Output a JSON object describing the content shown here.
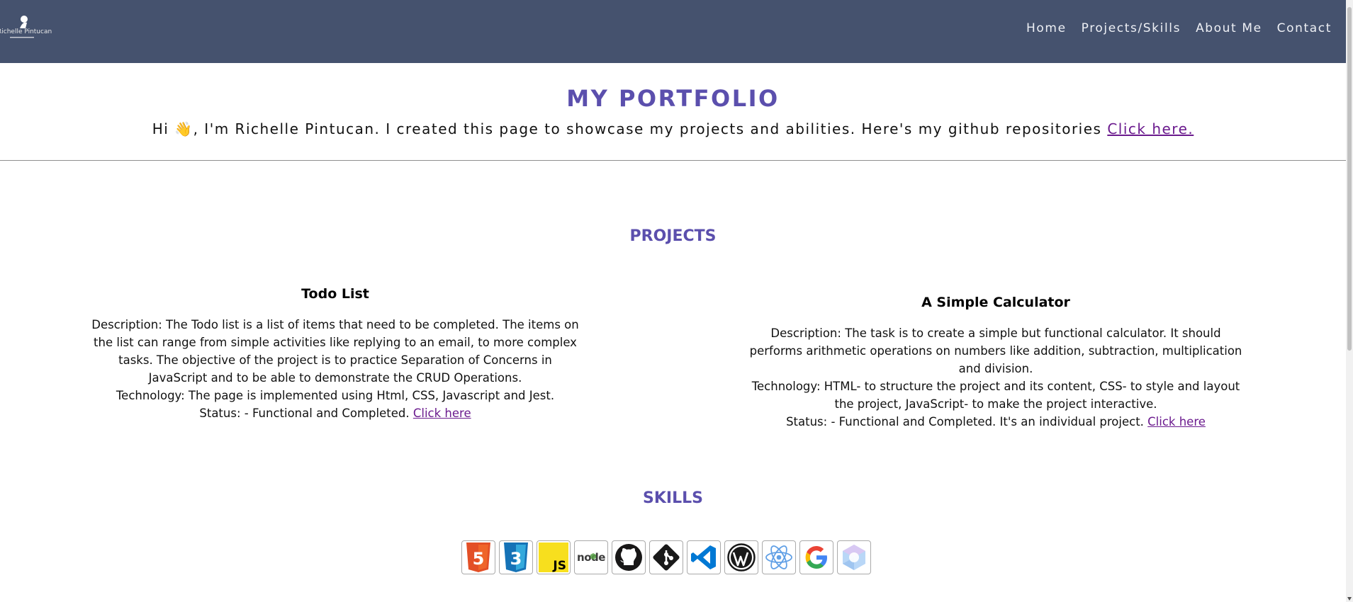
{
  "header": {
    "logo_text": "Richelle Pintucan",
    "nav": [
      "Home",
      "Projects/Skills",
      "About Me",
      "Contact"
    ]
  },
  "intro": {
    "title": "MY PORTFOLIO",
    "text": "Hi 👋, I'm Richelle Pintucan. I created this page to showcase my projects and abilities. Here's my github repositories ",
    "link": "Click here."
  },
  "projects": {
    "title": "PROJECTS",
    "items": [
      {
        "name": "Todo List",
        "description": "Description: The Todo list is a list of items that need to be completed. The items on the list can range from simple activities like replying to an email, to more complex tasks. The objective of the project is to practice Separation of Concerns in JavaScript and to be able to demonstrate the CRUD Operations.",
        "technology": "Technology: The page is implemented using Html, CSS, Javascript and Jest.",
        "status": "Status: - Functional and Completed. ",
        "link": "Click here"
      },
      {
        "name": "A Simple Calculator",
        "description": "Description: The task is to create a simple but functional calculator. It should performs arithmetic operations on numbers like addition, subtraction, multiplication and division.",
        "technology": "Technology: HTML- to structure the project and its content, CSS- to style and layout the project, JavaScript- to make the project interactive.",
        "status": "Status: - Functional and Completed. It's an individual project. ",
        "link": "Click here"
      }
    ]
  },
  "skills": {
    "title": "SKILLS",
    "icons": [
      "html5-icon",
      "css3-icon",
      "javascript-icon",
      "nodejs-icon",
      "github-icon",
      "git-icon",
      "vscode-icon",
      "wordpress-icon",
      "react-icon",
      "google-icon",
      "power-automate-icon"
    ],
    "labels": {
      "javascript": "JS",
      "nodejs": "node",
      "html5": "5",
      "css3": "3"
    }
  },
  "colors": {
    "navbar": "#45526e",
    "accent": "#5b4fad",
    "link": "#6b1b8e"
  }
}
